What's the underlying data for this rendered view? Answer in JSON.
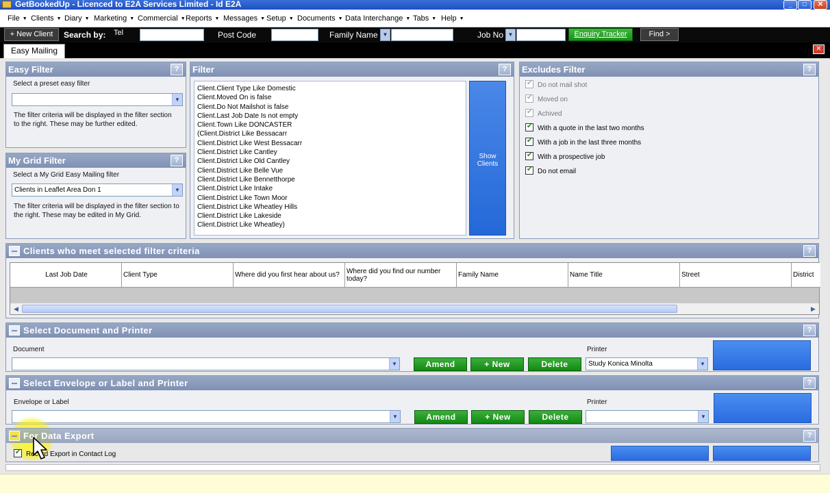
{
  "window": {
    "title": "GetBookedUp - Licenced to E2A Services Limited - Id E2A",
    "buttons": [
      "_",
      "□",
      "✕"
    ]
  },
  "menu": [
    "File",
    "Clients",
    "Diary",
    "Marketing",
    "Commercial",
    "Reports",
    "Messages",
    "Setup",
    "Documents",
    "Data Interchange",
    "Tabs",
    "Help"
  ],
  "searchbar": {
    "new_client": "+ New Client",
    "search_by": "Search by:",
    "tel": "Tel",
    "post_code": "Post Code",
    "family_name": "Family Name",
    "job_no": "Job No",
    "enquiry_tracker": "Enquiry Tracker",
    "find": "Find >"
  },
  "tabs": {
    "active": "Easy Mailing",
    "close": "✕"
  },
  "easy_filter": {
    "title": "Easy Filter",
    "help": "?",
    "select_label": "Select a preset easy filter",
    "value": "",
    "note": "The filter criteria will be displayed in the filter section to the right.  These may be further edited."
  },
  "my_grid_filter": {
    "title": "My Grid Filter",
    "help": "?",
    "select_label": "Select a My Grid Easy Mailing filter",
    "value": "Clients in Leaflet  Area Don 1",
    "note": "The filter criteria will be displayed in the filter section to the right.  These may be edited in My Grid."
  },
  "filter": {
    "title": "Filter",
    "help": "?",
    "lines": [
      "Client.Client Type Like Domestic",
      "Client.Moved On is false",
      "Client.Do Not Mailshot is false",
      "Client.Last Job Date Is not empty",
      "Client.Town Like DONCASTER",
      "(Client.District Like Bessacarr",
      "Client.District Like West Bessacarr",
      "Client.District Like Cantley",
      "Client.District Like Old Cantley",
      "Client.District Like Belle Vue",
      "Client.District Like Bennetthorpe",
      "Client.District Like Intake",
      "Client.District Like Town Moor",
      "Client.District Like Wheatley Hills",
      "Client.District Like Lakeside",
      "Client.District Like Wheatley)"
    ],
    "show_clients": [
      "Show",
      "Clients"
    ]
  },
  "excludes": {
    "title": "Excludes Filter",
    "help": "?",
    "items": [
      {
        "label": "Do not mail shot",
        "checked": true,
        "disabled": true
      },
      {
        "label": "Moved on",
        "checked": true,
        "disabled": true
      },
      {
        "label": "Achived",
        "checked": true,
        "disabled": true
      },
      {
        "label": "With a quote in the last two months",
        "checked": true,
        "disabled": false
      },
      {
        "label": "With a job in the last three months",
        "checked": true,
        "disabled": false
      },
      {
        "label": "With a prospective job",
        "checked": true,
        "disabled": false
      },
      {
        "label": "Do not email",
        "checked": true,
        "disabled": false
      }
    ]
  },
  "clients_grid": {
    "title": "Clients who meet selected filter criteria",
    "help": "?",
    "columns": [
      "Last Job Date",
      "Client Type",
      "Where did you first hear about us?",
      "Where did you find our number today?",
      "Family Name",
      "Name Title",
      "Street",
      "District"
    ]
  },
  "document_printer": {
    "title": "Select Document and Printer",
    "help": "?",
    "document_label": "Document",
    "document_value": "",
    "amend": "Amend",
    "new": "+ New",
    "delete": "Delete",
    "printer_label": "Printer",
    "printer_value": "Study Konica Minolta"
  },
  "envelope_printer": {
    "title": "Select Envelope or Label and Printer",
    "help": "?",
    "envelope_label": "Envelope or Label",
    "envelope_value": "",
    "amend": "Amend",
    "new": "+ New",
    "delete": "Delete",
    "printer_label": "Printer",
    "printer_value": ""
  },
  "data_export": {
    "title": "For Data Export",
    "help": "?",
    "record_label": "Record Export in Contact Log",
    "record_checked": true
  }
}
